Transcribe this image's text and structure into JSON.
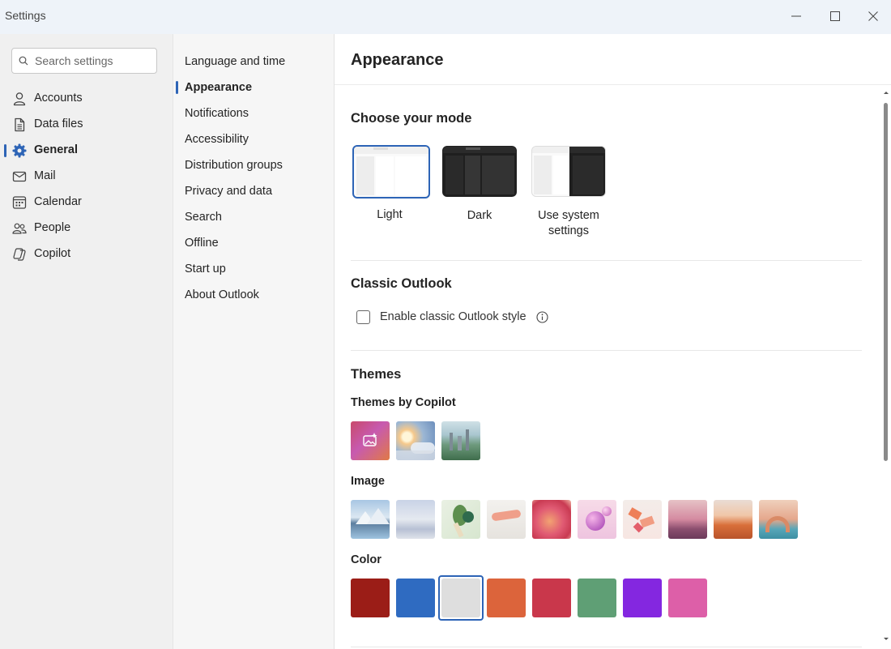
{
  "window": {
    "title": "Settings"
  },
  "search": {
    "placeholder": "Search settings"
  },
  "nav_primary": [
    {
      "label": "Accounts",
      "icon": "person-icon"
    },
    {
      "label": "Data files",
      "icon": "document-icon"
    },
    {
      "label": "General",
      "icon": "gear-icon",
      "active": true
    },
    {
      "label": "Mail",
      "icon": "mail-icon"
    },
    {
      "label": "Calendar",
      "icon": "calendar-icon"
    },
    {
      "label": "People",
      "icon": "people-icon"
    },
    {
      "label": "Copilot",
      "icon": "copilot-icon"
    }
  ],
  "nav_secondary": [
    {
      "label": "Language and time"
    },
    {
      "label": "Appearance",
      "active": true
    },
    {
      "label": "Notifications"
    },
    {
      "label": "Accessibility"
    },
    {
      "label": "Distribution groups"
    },
    {
      "label": "Privacy and data"
    },
    {
      "label": "Search"
    },
    {
      "label": "Offline"
    },
    {
      "label": "Start up"
    },
    {
      "label": "About Outlook"
    }
  ],
  "main": {
    "title": "Appearance",
    "mode": {
      "heading": "Choose your mode",
      "options": [
        {
          "label": "Light",
          "selected": true
        },
        {
          "label": "Dark"
        },
        {
          "label": "Use system settings"
        }
      ]
    },
    "classic": {
      "heading": "Classic Outlook",
      "checkbox_label": "Enable classic Outlook style",
      "checked": false
    },
    "themes": {
      "heading": "Themes",
      "copilot_heading": "Themes by Copilot",
      "copilot_count": 3,
      "image_heading": "Image",
      "image_count": 10,
      "color_heading": "Color",
      "colors": [
        "#9b1d17",
        "#2f6bc1",
        "#dedede",
        "#dc643b",
        "#c9374b",
        "#5f9f75",
        "#8427e0",
        "#dd5fa8"
      ],
      "selected_color_index": 2
    }
  },
  "colors": {
    "accent": "#2d64b6"
  }
}
